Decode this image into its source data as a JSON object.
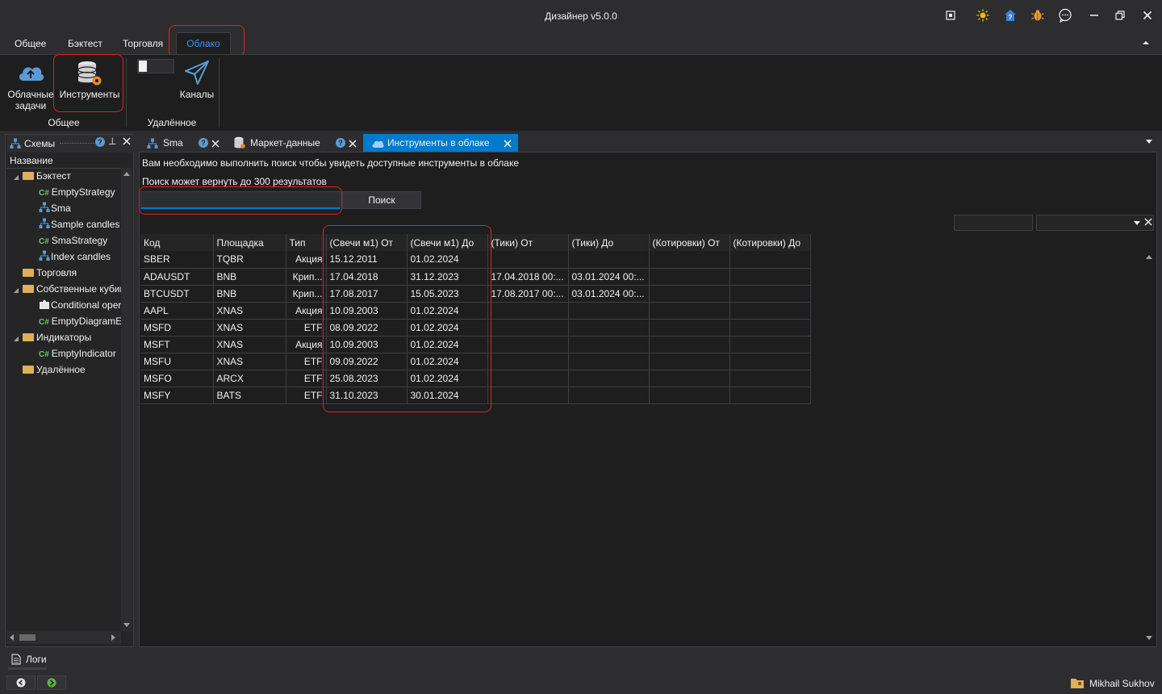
{
  "window": {
    "title": "Дизайнер v5.0.0"
  },
  "menu": {
    "tabs": [
      "Общее",
      "Бэктест",
      "Торговля",
      "Облако"
    ],
    "active": "Облако"
  },
  "ribbon": {
    "buttons": [
      {
        "label_line1": "Облачные",
        "label_line2": "задачи",
        "icon": "cloud-upload-icon"
      },
      {
        "label_line1": "Инструменты",
        "label_line2": "",
        "icon": "database-gear-icon"
      },
      {
        "label_line1": "Каналы",
        "label_line2": "",
        "icon": "paper-plane-icon"
      }
    ],
    "groups": [
      "Общее",
      "Удалённое"
    ]
  },
  "left_panel": {
    "title": "Схемы",
    "column": "Название",
    "items": [
      {
        "label": "Бэктест",
        "kind": "folder",
        "level": 0,
        "expanded": true
      },
      {
        "label": "EmptyStrategy",
        "kind": "cs",
        "level": 1
      },
      {
        "label": "Sma",
        "kind": "schema",
        "level": 1
      },
      {
        "label": "Sample candles",
        "kind": "schema",
        "level": 1
      },
      {
        "label": "SmaStrategy",
        "kind": "cs",
        "level": 1
      },
      {
        "label": "Index candles",
        "kind": "schema",
        "level": 1
      },
      {
        "label": "Торговля",
        "kind": "folder",
        "level": 0,
        "expanded": false
      },
      {
        "label": "Собственные кубики",
        "kind": "folder",
        "level": 0,
        "expanded": true
      },
      {
        "label": "Conditional operator",
        "kind": "puzzle",
        "level": 1
      },
      {
        "label": "EmptyDiagramElement",
        "kind": "cs",
        "level": 1
      },
      {
        "label": "Индикаторы",
        "kind": "folder",
        "level": 0,
        "expanded": true
      },
      {
        "label": "EmptyIndicator",
        "kind": "cs",
        "level": 1
      },
      {
        "label": "Удалённое",
        "kind": "folder",
        "level": 0,
        "expanded": false
      }
    ],
    "logs_label": "Логи"
  },
  "doc_tabs": [
    {
      "label": "Sma",
      "icon": "schema-icon"
    },
    {
      "label": "Маркет-данные",
      "icon": "database-icon"
    },
    {
      "label": "Инструменты в облаке",
      "icon": "cloud-icon",
      "active": true
    }
  ],
  "content": {
    "info_line1": "Вам необходимо выполнить поиск чтобы увидеть доступные инструменты в облаке",
    "info_line2": "Поиск может вернуть до 300 результатов",
    "search_value": "",
    "search_button": "Поиск"
  },
  "table": {
    "columns": [
      "Код",
      "Площадка",
      "Тип",
      "(Свечи м1) От",
      "(Свечи м1) До",
      "(Тики) От",
      "(Тики) До",
      "(Котировки) От",
      "(Котировки) До"
    ],
    "rows": [
      [
        "SBER",
        "TQBR",
        "Акция",
        "15.12.2011",
        "01.02.2024",
        "",
        "",
        "",
        ""
      ],
      [
        "ADAUSDT",
        "BNB",
        "Крип...",
        "17.04.2018",
        "31.12.2023",
        "17.04.2018 00:...",
        "03.01.2024 00:...",
        "",
        ""
      ],
      [
        "BTCUSDT",
        "BNB",
        "Крип...",
        "17.08.2017",
        "15.05.2023",
        "17.08.2017 00:...",
        "03.01.2024 00:...",
        "",
        ""
      ],
      [
        "AAPL",
        "XNAS",
        "Акция",
        "10.09.2003",
        "01.02.2024",
        "",
        "",
        "",
        ""
      ],
      [
        "MSFD",
        "XNAS",
        "ETF",
        "08.09.2022",
        "01.02.2024",
        "",
        "",
        "",
        ""
      ],
      [
        "MSFT",
        "XNAS",
        "Акция",
        "10.09.2003",
        "01.02.2024",
        "",
        "",
        "",
        ""
      ],
      [
        "MSFU",
        "XNAS",
        "ETF",
        "09.09.2022",
        "01.02.2024",
        "",
        "",
        "",
        ""
      ],
      [
        "MSFO",
        "ARCX",
        "ETF",
        "25.08.2023",
        "01.02.2024",
        "",
        "",
        "",
        ""
      ],
      [
        "MSFY",
        "BATS",
        "ETF",
        "31.10.2023",
        "30.01.2024",
        "",
        "",
        "",
        ""
      ]
    ]
  },
  "status": {
    "user": "Mikhail Sukhov"
  }
}
